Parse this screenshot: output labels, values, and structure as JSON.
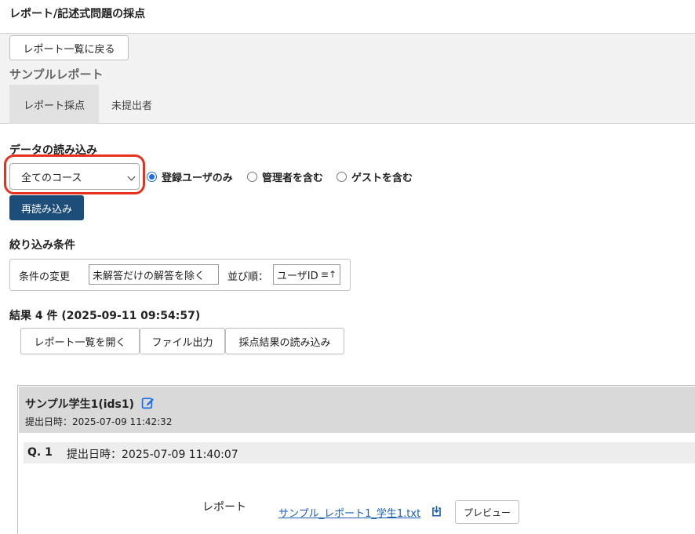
{
  "page_title": "レポート/記述式問題の採点",
  "back_button": "レポート一覧に戻る",
  "report_name": "サンプルレポート",
  "tabs": [
    {
      "label": "レポート採点"
    },
    {
      "label": "未提出者"
    }
  ],
  "data_load": {
    "heading": "データの読み込み",
    "course_select": "全てのコース",
    "radio_options": [
      {
        "label": "登録ユーザのみ",
        "checked": true
      },
      {
        "label": "管理者を含む",
        "checked": false
      },
      {
        "label": "ゲストを含む",
        "checked": false
      }
    ],
    "reload_button": "再読み込み"
  },
  "filter": {
    "heading": "絞り込み条件",
    "change_label": "条件の変更",
    "condition_value": "未解答だけの解答を除く",
    "sort_label": "並び順：",
    "sort_value": "ユーザID",
    "sort_icon": "sort-ascending-icon"
  },
  "results": {
    "heading": "結果 4 件 (2025-09-11 09:54:57)",
    "buttons": [
      "レポート一覧を開く",
      "ファイル出力",
      "採点結果の読み込み"
    ]
  },
  "student": {
    "name": "サンプル学生1(ids1)",
    "submitted": "提出日時：2025-07-09 11:42:32",
    "question": {
      "number": "Q. 1",
      "submitted": "提出日時：2025-07-09 11:40:07",
      "report_label": "レポート",
      "file_name": "サンプル_レポート1_学生1.txt",
      "preview_button": "プレビュー"
    }
  },
  "colors": {
    "primary": "#1d4e7a",
    "highlight": "#e8301e",
    "link": "#1a5fb4",
    "radio_accent": "#1a6fe8"
  }
}
